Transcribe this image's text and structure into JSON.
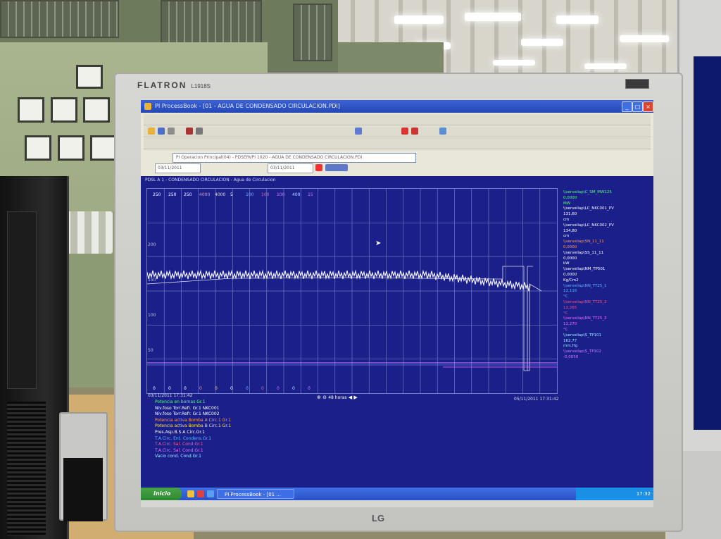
{
  "monitor": {
    "brand": "FLATRON",
    "model": "L1918S",
    "maker": "LG"
  },
  "window": {
    "title": "PI ProcessBook - [01 - AGUA DE CONDENSADO CIRCULACION.PDI]",
    "address": "PI Operacion Principal(04) - PDSERVPI 1020 - AGUA DE CONDENSADO CIRCULACION.PDI",
    "start_time": "03/11/2011",
    "end_time": "03/11/2011"
  },
  "plot": {
    "title": "PDSL A 1 - CONDENSADO CIRCULACION - Agua de Circulacion",
    "top_scales": [
      {
        "text": "250",
        "color": "#ffffff"
      },
      {
        "text": "250",
        "color": "#ffffff"
      },
      {
        "text": "250",
        "color": "#ffffff"
      },
      {
        "text": "4000",
        "color": "#ff9b62"
      },
      {
        "text": "4000",
        "color": "#ffe35a"
      },
      {
        "text": "5",
        "color": "#ffffff"
      },
      {
        "text": "100",
        "color": "#5fb7ff"
      },
      {
        "text": "100",
        "color": "#ff5f8f"
      },
      {
        "text": "100",
        "color": "#ff66ff"
      },
      {
        "text": "400",
        "color": "#9af0ff"
      },
      {
        "text": "15",
        "color": "#d07bff"
      }
    ],
    "bottom_scales": [
      {
        "text": "0",
        "color": "#ffffff"
      },
      {
        "text": "0",
        "color": "#ffffff"
      },
      {
        "text": "0",
        "color": "#ffffff"
      },
      {
        "text": "0",
        "color": "#ff9b62"
      },
      {
        "text": "0",
        "color": "#ffe35a"
      },
      {
        "text": "0",
        "color": "#ffffff"
      },
      {
        "text": "0",
        "color": "#5fb7ff"
      },
      {
        "text": "0",
        "color": "#ff5f8f"
      },
      {
        "text": "0",
        "color": "#ff66ff"
      },
      {
        "text": "0",
        "color": "#9af0ff"
      },
      {
        "text": "0",
        "color": "#d07bff"
      }
    ],
    "y_ticks": [
      "200",
      "150",
      "100",
      "50"
    ],
    "time_start": "03/11/2011 17:31:42",
    "time_end": "05/11/2011 17:31:42",
    "time_span": "48 horas"
  },
  "legend": [
    {
      "text": "\\\\serveilap\\C_SM_MW125",
      "color": "#5cff7c"
    },
    {
      "text": "0,0000",
      "color": "#5cff7c"
    },
    {
      "text": "MW",
      "color": "#5cff7c"
    },
    {
      "text": "\\\\serveilap\\LC_NKC001_PV",
      "color": "#ffffff"
    },
    {
      "text": "131,60",
      "color": "#ffffff"
    },
    {
      "text": "cm",
      "color": "#ffffff"
    },
    {
      "text": "\\\\serveilap\\LC_NKC002_PV",
      "color": "#ffffff"
    },
    {
      "text": "134,80",
      "color": "#ffffff"
    },
    {
      "text": "cm",
      "color": "#ffffff"
    },
    {
      "text": "\\\\serveilap\\SN_11_11",
      "color": "#ff9b62"
    },
    {
      "text": "0,0000",
      "color": "#ff9b62"
    },
    {
      "text": "\\\\serveilap\\SS_11_11",
      "color": "#ffffff"
    },
    {
      "text": "0,0000",
      "color": "#ffffff"
    },
    {
      "text": "kW",
      "color": "#ffffff"
    },
    {
      "text": "\\\\serveilap\\NM_TP501",
      "color": "#ffffff"
    },
    {
      "text": "0,0000",
      "color": "#ffffff"
    },
    {
      "text": "Kg/Cm2",
      "color": "#ffffff"
    },
    {
      "text": "\\\\serveilap\\NN_TT25_1",
      "color": "#5fb7ff"
    },
    {
      "text": "12,116",
      "color": "#5fb7ff"
    },
    {
      "text": "°C",
      "color": "#5fb7ff"
    },
    {
      "text": "\\\\serveilap\\NN_TT25_2",
      "color": "#ff4f7f"
    },
    {
      "text": "12,265",
      "color": "#ff4f7f"
    },
    {
      "text": "°C",
      "color": "#ff4f7f"
    },
    {
      "text": "\\\\serveilap\\NN_TT25_3",
      "color": "#ff66ff"
    },
    {
      "text": "12,270",
      "color": "#ff66ff"
    },
    {
      "text": "°C",
      "color": "#ff66ff"
    },
    {
      "text": "\\\\serveilap\\S_TP101",
      "color": "#9af0ff"
    },
    {
      "text": "162,77",
      "color": "#9af0ff"
    },
    {
      "text": "mm.Hg",
      "color": "#9af0ff"
    },
    {
      "text": "\\\\serveilap\\S_TP102",
      "color": "#d07bff"
    },
    {
      "text": "-0,0050",
      "color": "#d07bff"
    }
  ],
  "descriptions": [
    {
      "text": "Potencia en bornas Gr.1",
      "color": "#5cff7c"
    },
    {
      "text": "Niv.foso Torr.Refr. Gr.1 NKC001",
      "color": "#ffffff"
    },
    {
      "text": "Niv.foso Torr.Refr. Gr.1 NKC002",
      "color": "#ffffff"
    },
    {
      "text": "Potencia activa Bomba A Circ.1 Gr.1",
      "color": "#ff9b62"
    },
    {
      "text": "Potencia activa Bomba B Circ.1 Gr.1",
      "color": "#ffe35a"
    },
    {
      "text": "Pres.Asp.B.S.A Circ.Gr.1",
      "color": "#ffffff"
    },
    {
      "text": "T.A.Circ. Ent. Condens.Gr.1",
      "color": "#5fb7ff"
    },
    {
      "text": "T.A.Circ. Sal. Cond.Gr.1",
      "color": "#ff5f8f"
    },
    {
      "text": "T.A.Circ. Sal. Cond.Gr.1",
      "color": "#ff66ff"
    },
    {
      "text": "Vacio cond. Cond.Gr.1",
      "color": "#9af0ff"
    },
    {
      "text": "",
      "color": "#d07bff"
    }
  ],
  "taskbar": {
    "start_label": "Inicio",
    "task_label": "PI ProcessBook - [01 ...",
    "clock": "17:32"
  }
}
